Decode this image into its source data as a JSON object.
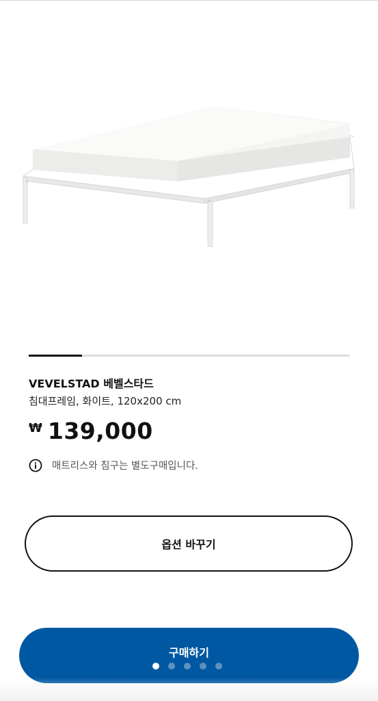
{
  "product": {
    "name": "VEVELSTAD 베벨스타드",
    "description": "침대프레임, 화이트, 120x200 cm",
    "price_currency": "₩",
    "price_value": "139,000",
    "notice": "매트리스와 침구는 별도구매입니다.",
    "image_icon": "bed-frame-product-image"
  },
  "gallery": {
    "progress_fraction": 0.165,
    "page_count": 5,
    "active_page": 1
  },
  "actions": {
    "change_options_label": "옵션 바꾸기",
    "buy_label": "구매하기"
  },
  "colors": {
    "buy_button": "#0058a3",
    "text": "#111111",
    "muted_text": "#555555",
    "progress_track": "#dcdcdc"
  }
}
